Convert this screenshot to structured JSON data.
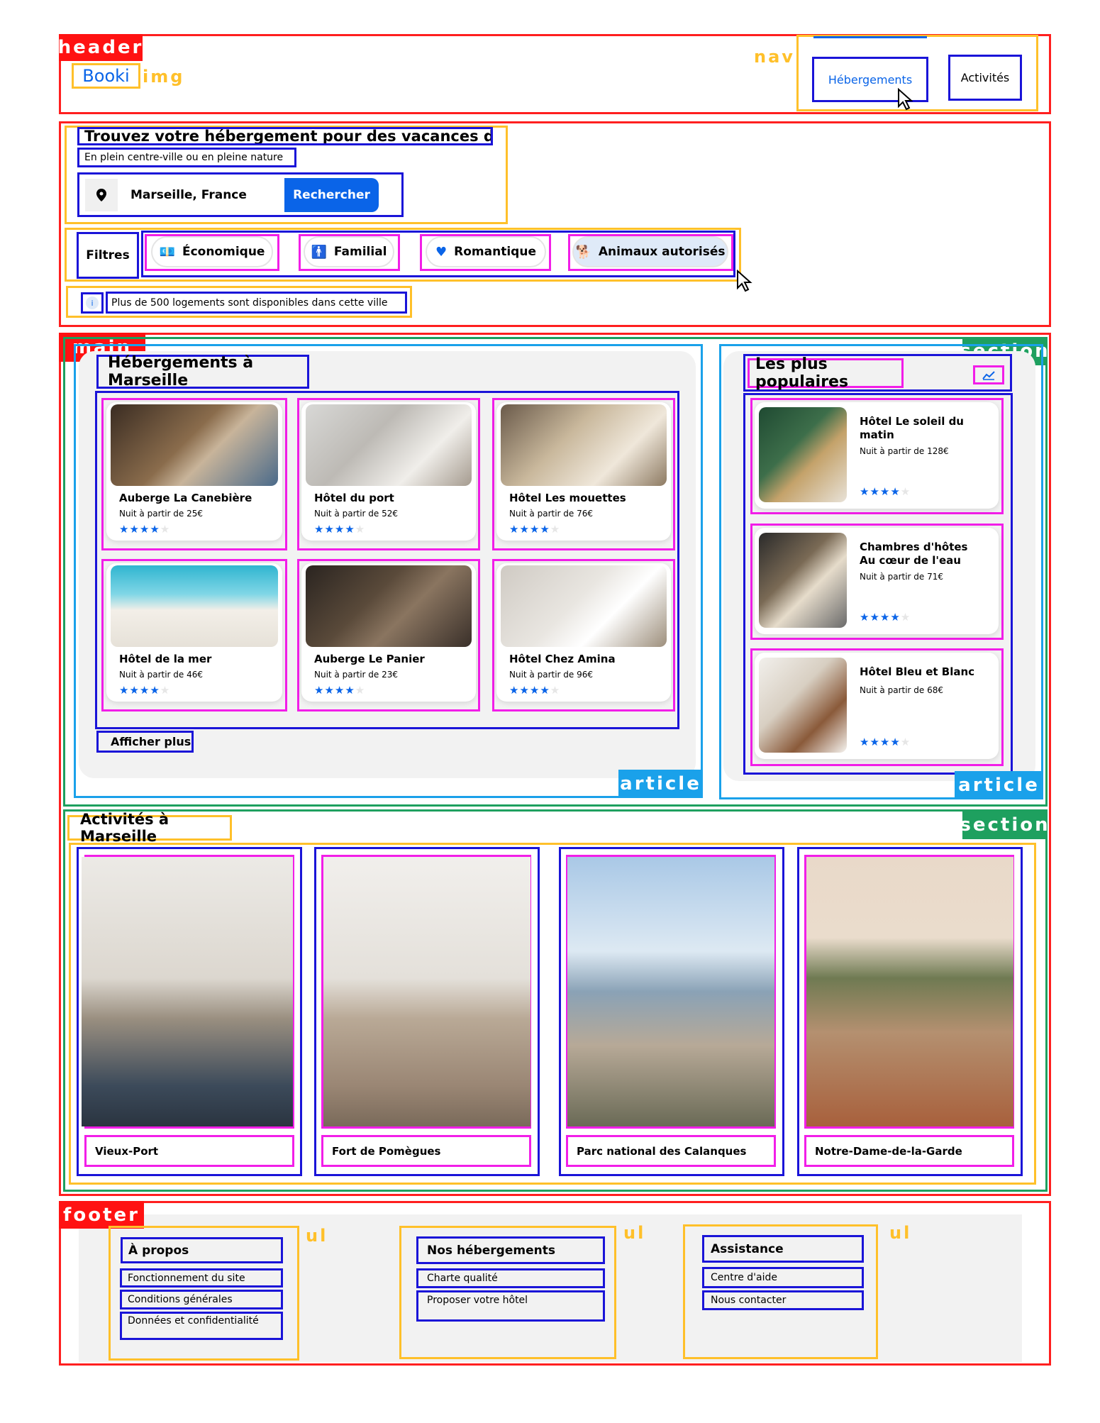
{
  "header": {
    "tag": "header",
    "logo": "Booki",
    "logo_tag": "img",
    "nav_tag": "nav",
    "nav_items": [
      "Hébergements",
      "Activités"
    ]
  },
  "search": {
    "title": "Trouvez votre hébergement pour des vacances de rêve",
    "subtitle": "En plein centre-ville ou en pleine nature",
    "location": "Marseille, France",
    "button": "Rechercher"
  },
  "filters": {
    "label": "Filtres",
    "items": [
      {
        "label": "Économique",
        "icon": "money-icon"
      },
      {
        "label": "Familial",
        "icon": "person-icon"
      },
      {
        "label": "Romantique",
        "icon": "heart-icon"
      },
      {
        "label": "Animaux autorisés",
        "icon": "dog-icon"
      }
    ]
  },
  "info": {
    "icon": "i",
    "text": "Plus de 500 logements sont disponibles dans cette ville"
  },
  "main": {
    "tag": "main",
    "section_tag": "section",
    "article_tag": "article",
    "hebergements_title": "Hébergements à Marseille",
    "hotels": [
      {
        "name": "Auberge La Canebière",
        "price": "Nuit à partir de 25€",
        "stars": 4
      },
      {
        "name": "Hôtel du port",
        "price": "Nuit à partir de 52€",
        "stars": 4
      },
      {
        "name": "Hôtel Les mouettes",
        "price": "Nuit à partir de 76€",
        "stars": 4
      },
      {
        "name": "Hôtel de la mer",
        "price": "Nuit à partir de 46€",
        "stars": 4
      },
      {
        "name": "Auberge Le Panier",
        "price": "Nuit à partir de 23€",
        "stars": 4
      },
      {
        "name": "Hôtel Chez Amina",
        "price": "Nuit à partir de 96€",
        "stars": 4
      }
    ],
    "show_more": "Afficher plus",
    "popular_title": "Les plus populaires",
    "popular": [
      {
        "name": "Hôtel Le soleil du matin",
        "price": "Nuit à partir de 128€",
        "stars": 4
      },
      {
        "name": "Chambres d'hôtes Au cœur de l'eau",
        "price": "Nuit à partir de 71€",
        "stars": 4
      },
      {
        "name": "Hôtel Bleu et Blanc",
        "price": "Nuit à partir de 68€",
        "stars": 4
      }
    ]
  },
  "activities": {
    "title": "Activités à Marseille",
    "items": [
      "Vieux-Port",
      "Fort de Pomègues",
      "Parc national des Calanques",
      "Notre-Dame-de-la-Garde"
    ]
  },
  "footer": {
    "tag": "footer",
    "ul_tag": "ul",
    "columns": [
      {
        "title": "À propos",
        "links": [
          "Fonctionnement du site",
          "Conditions générales",
          "Données et confidentialité"
        ]
      },
      {
        "title": "Nos hébergements",
        "links": [
          "Charte qualité",
          "Proposer votre hôtel"
        ]
      },
      {
        "title": "Assistance",
        "links": [
          "Centre d'aide",
          "Nous contacter"
        ]
      }
    ]
  },
  "colors": {
    "accent": "#0a64e8",
    "header_box": "#ff1f1f",
    "item_box": "#1a14d8",
    "group_box": "#ffc02a",
    "card_box": "#f21ee8",
    "section_box": "#1ea05f",
    "article_box": "#1aa1ea"
  }
}
